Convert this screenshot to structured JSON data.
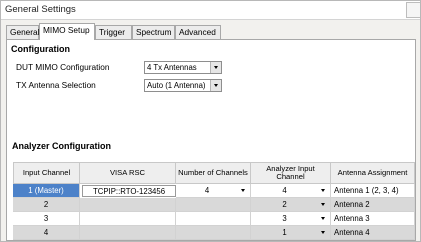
{
  "window": {
    "title": "General Settings"
  },
  "tabs": [
    {
      "label": "General",
      "active": false
    },
    {
      "label": "MIMO Setup",
      "active": true
    },
    {
      "label": "Trigger",
      "active": false
    },
    {
      "label": "Spectrum",
      "active": false
    },
    {
      "label": "Advanced",
      "active": false
    }
  ],
  "configuration": {
    "title": "Configuration",
    "dut_mimo": {
      "label": "DUT MIMO Configuration",
      "value": "4 Tx Antennas"
    },
    "tx_antenna": {
      "label": "TX Antenna Selection",
      "value": "Auto (1 Antenna)"
    }
  },
  "analyzer": {
    "title": "Analyzer Configuration",
    "columns": [
      "Input Channel",
      "VISA RSC",
      "Number of Channels",
      "Analyzer Input Channel",
      "Antenna Assignment"
    ],
    "rows": [
      {
        "input_channel": "1 (Master)",
        "visa": "TCPIP::RTO-123456",
        "num_channels": "4",
        "analyzer_input": "4",
        "antenna": "Antenna 1 (2, 3, 4)",
        "selected": true
      },
      {
        "input_channel": "2",
        "visa": "",
        "num_channels": "",
        "analyzer_input": "2",
        "antenna": "Antenna 2",
        "selected": false
      },
      {
        "input_channel": "3",
        "visa": "",
        "num_channels": "",
        "analyzer_input": "3",
        "antenna": "Antenna 3",
        "selected": false
      },
      {
        "input_channel": "4",
        "visa": "",
        "num_channels": "",
        "analyzer_input": "1",
        "antenna": "Antenna 4",
        "selected": false
      }
    ]
  },
  "colors": {
    "selection": "#4d82c9",
    "row_gray": "#d9d9d9",
    "header_bg": "#eeeeee"
  }
}
